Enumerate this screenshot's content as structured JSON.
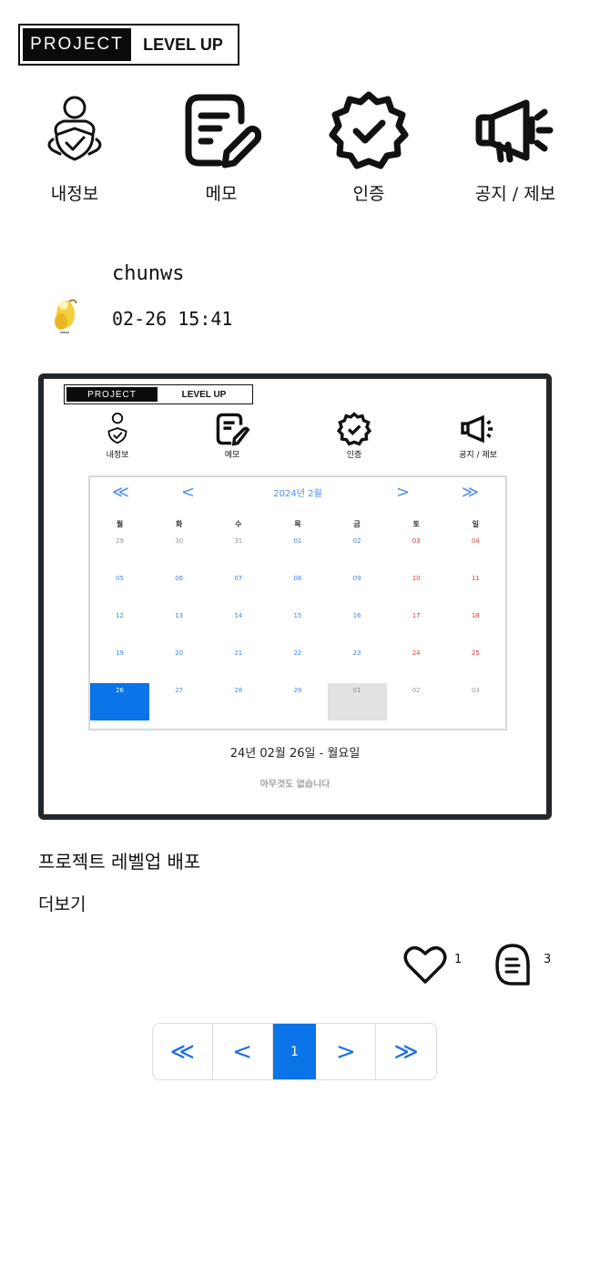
{
  "logo": {
    "part1": "PROJECT",
    "part2": "LEVEL UP"
  },
  "nav": [
    {
      "label": "내정보",
      "icon": "user-shield-icon"
    },
    {
      "label": "메모",
      "icon": "memo-edit-icon"
    },
    {
      "label": "인증",
      "icon": "verified-badge-icon"
    },
    {
      "label": "공지 / 제보",
      "icon": "megaphone-icon"
    }
  ],
  "post": {
    "author": "chunws",
    "time": "02-26 15:41",
    "title": "프로젝트 레벨업 배포",
    "more": "더보기",
    "likes": "1",
    "comments": "3"
  },
  "image": {
    "logo1": "PROJECT",
    "logo2": "LEVEL UP",
    "nav": [
      "내정보",
      "메모",
      "인증",
      "공지 / 제보"
    ],
    "calendar": {
      "title": "2024년 2월",
      "prev_year": "≪",
      "prev_month": "<",
      "next_month": ">",
      "next_year": "≫",
      "weekdays": [
        "월",
        "화",
        "수",
        "목",
        "금",
        "토",
        "일"
      ],
      "weeks": [
        [
          "29",
          "30",
          "31",
          "01",
          "02",
          "03",
          "04"
        ],
        [
          "05",
          "06",
          "07",
          "08",
          "09",
          "10",
          "11"
        ],
        [
          "12",
          "13",
          "14",
          "15",
          "16",
          "17",
          "18"
        ],
        [
          "19",
          "20",
          "21",
          "22",
          "23",
          "24",
          "25"
        ],
        [
          "26",
          "27",
          "28",
          "29",
          "01",
          "02",
          "03"
        ]
      ]
    },
    "date_line": "24년 02월 26일 - 월요일",
    "sub_line": "아무것도 없습니다"
  },
  "pagination": {
    "first": "≪",
    "prev": "<",
    "current": "1",
    "next": ">",
    "last": "≫"
  },
  "colors": {
    "accent": "#0a74e8",
    "link_blue": "#1f6fe0",
    "weekend_red": "#e23b3b"
  }
}
